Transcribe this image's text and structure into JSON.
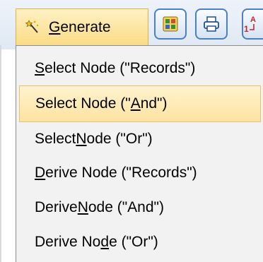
{
  "menu": {
    "title_mnemonic": "G",
    "title_rest": "enerate",
    "title_icon": "magic-wand-icon"
  },
  "toolbar": {
    "buttons": [
      {
        "name": "node-palette-button",
        "icon": "node-palette-icon"
      },
      {
        "name": "print-button",
        "icon": "printer-icon"
      },
      {
        "name": "sort-button",
        "icon": "sort-icon"
      }
    ]
  },
  "items": [
    {
      "pre": "",
      "mn": "S",
      "post": "elect Node (\"Records\")",
      "highlighted": false
    },
    {
      "pre": "Select Node (\"",
      "mn": "A",
      "post": "nd\")",
      "highlighted": true
    },
    {
      "pre": "Select ",
      "mn": "N",
      "post": "ode (\"Or\")",
      "highlighted": false
    },
    {
      "pre": "",
      "mn": "D",
      "post": "erive Node (\"Records\")",
      "highlighted": false
    },
    {
      "pre": "Derive ",
      "mn": "N",
      "post": "ode (\"And\")",
      "highlighted": false
    },
    {
      "pre": "Derive No",
      "mn": "d",
      "post": "e (\"Or\")",
      "highlighted": false
    }
  ]
}
